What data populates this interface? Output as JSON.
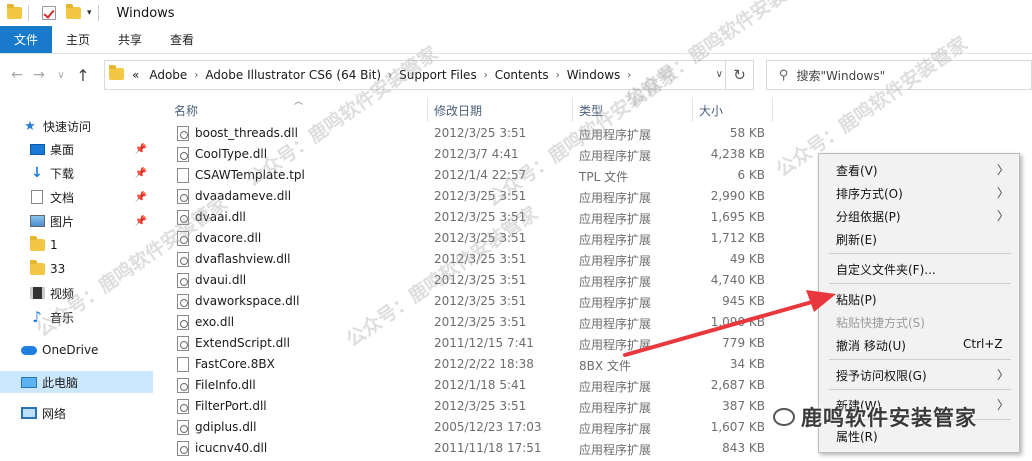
{
  "window": {
    "title": "Windows"
  },
  "ribbon": {
    "tabs": [
      "文件",
      "主页",
      "共享",
      "查看"
    ]
  },
  "address": {
    "crumbs": [
      "Adobe",
      "Adobe Illustrator CS6 (64 Bit)",
      "Support Files",
      "Contents",
      "Windows"
    ],
    "overflow": "«"
  },
  "search": {
    "placeholder": "搜索\"Windows\""
  },
  "sidebar": {
    "items": [
      {
        "label": "快速访问",
        "icon": "star-icon"
      },
      {
        "label": "桌面",
        "icon": "desktop-icon",
        "pinned": true
      },
      {
        "label": "下载",
        "icon": "download-icon",
        "pinned": true
      },
      {
        "label": "文档",
        "icon": "document-icon",
        "pinned": true
      },
      {
        "label": "图片",
        "icon": "pictures-icon",
        "pinned": true
      },
      {
        "label": "1",
        "icon": "folder-icon"
      },
      {
        "label": "33",
        "icon": "folder-icon"
      },
      {
        "label": "视频",
        "icon": "video-icon"
      },
      {
        "label": "音乐",
        "icon": "music-icon"
      },
      {
        "label": "OneDrive",
        "icon": "onedrive-icon"
      },
      {
        "label": "此电脑",
        "icon": "this-pc-icon",
        "selected": true
      },
      {
        "label": "网络",
        "icon": "network-icon"
      }
    ]
  },
  "columns": {
    "name": "名称",
    "date": "修改日期",
    "type": "类型",
    "size": "大小"
  },
  "files": [
    {
      "name": "boost_threads.dll",
      "date": "2012/3/25 3:51",
      "type": "应用程序扩展",
      "size": "58 KB",
      "kind": "dll"
    },
    {
      "name": "CoolType.dll",
      "date": "2012/3/7 4:41",
      "type": "应用程序扩展",
      "size": "4,238 KB",
      "kind": "dll"
    },
    {
      "name": "CSAWTemplate.tpl",
      "date": "2012/1/4 22:57",
      "type": "TPL 文件",
      "size": "6 KB",
      "kind": "file"
    },
    {
      "name": "dvaadameve.dll",
      "date": "2012/3/25 3:51",
      "type": "应用程序扩展",
      "size": "2,990 KB",
      "kind": "dll"
    },
    {
      "name": "dvaai.dll",
      "date": "2012/3/25 3:51",
      "type": "应用程序扩展",
      "size": "1,695 KB",
      "kind": "dll"
    },
    {
      "name": "dvacore.dll",
      "date": "2012/3/25 3:51",
      "type": "应用程序扩展",
      "size": "1,712 KB",
      "kind": "dll"
    },
    {
      "name": "dvaflashview.dll",
      "date": "2012/3/25 3:51",
      "type": "应用程序扩展",
      "size": "49 KB",
      "kind": "dll"
    },
    {
      "name": "dvaui.dll",
      "date": "2012/3/25 3:51",
      "type": "应用程序扩展",
      "size": "4,740 KB",
      "kind": "dll"
    },
    {
      "name": "dvaworkspace.dll",
      "date": "2012/3/25 3:51",
      "type": "应用程序扩展",
      "size": "945 KB",
      "kind": "dll"
    },
    {
      "name": "exo.dll",
      "date": "2012/3/25 3:51",
      "type": "应用程序扩展",
      "size": "1,090 KB",
      "kind": "dll"
    },
    {
      "name": "ExtendScript.dll",
      "date": "2011/12/15 7:41",
      "type": "应用程序扩展",
      "size": "779 KB",
      "kind": "dll"
    },
    {
      "name": "FastCore.8BX",
      "date": "2012/2/22 18:38",
      "type": "8BX 文件",
      "size": "34 KB",
      "kind": "file"
    },
    {
      "name": "FileInfo.dll",
      "date": "2012/1/18 5:41",
      "type": "应用程序扩展",
      "size": "2,687 KB",
      "kind": "dll"
    },
    {
      "name": "FilterPort.dll",
      "date": "2012/3/25 3:51",
      "type": "应用程序扩展",
      "size": "387 KB",
      "kind": "dll"
    },
    {
      "name": "gdiplus.dll",
      "date": "2005/12/23 17:03",
      "type": "应用程序扩展",
      "size": "1,607 KB",
      "kind": "dll"
    },
    {
      "name": "icucnv40.dll",
      "date": "2011/11/18 17:51",
      "type": "应用程序扩展",
      "size": "843 KB",
      "kind": "dll"
    }
  ],
  "context_menu": {
    "items": [
      {
        "label": "查看(V)",
        "submenu": true
      },
      {
        "label": "排序方式(O)",
        "submenu": true
      },
      {
        "label": "分组依据(P)",
        "submenu": true
      },
      {
        "label": "刷新(E)"
      },
      {
        "label": "自定义文件夹(F)..."
      },
      {
        "label": "粘贴(P)"
      },
      {
        "label": "粘贴快捷方式(S)",
        "disabled": true
      },
      {
        "label": "撤消 移动(U)",
        "shortcut": "Ctrl+Z"
      },
      {
        "label": "授予访问权限(G)",
        "submenu": true
      },
      {
        "label": "新建(W)",
        "submenu": true
      },
      {
        "label": "属性(R)"
      }
    ]
  },
  "watermark": {
    "text": "公众号：鹿鸣软件安装管家",
    "brand": "鹿鸣软件安装管家"
  },
  "colors": {
    "accent": "#1979ca",
    "selection": "#cce8ff",
    "arrow": "#e8383d"
  }
}
